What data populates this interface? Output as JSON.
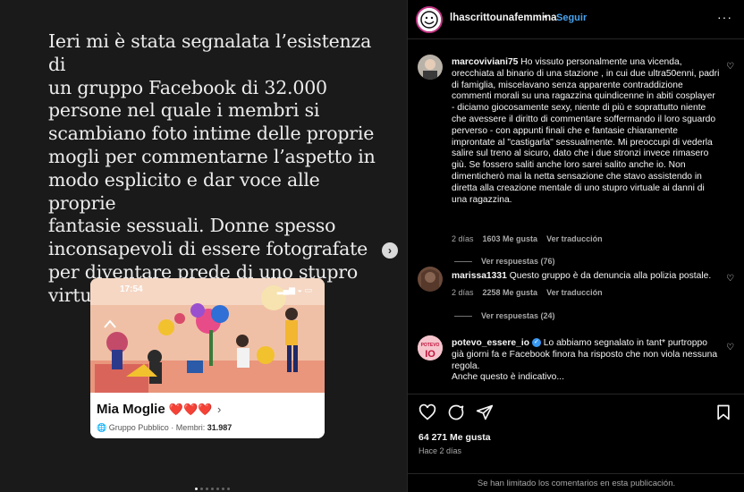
{
  "media": {
    "text_lines": [
      "Ieri mi è stata segnalata l’esistenza di",
      "un gruppo Facebook di 32.000",
      "persone nel quale i membri si",
      "scambiano foto intime delle proprie",
      "mogli per commentarne l’aspetto in",
      "modo esplicito e dar voce alle proprie",
      "fantasie sessuali. Donne spesso",
      "inconsapevoli di essere fotografate",
      "per diventare prede di uno stupro",
      "virtuale."
    ],
    "card": {
      "time": "17:54",
      "title": "Mia Moglie",
      "hearts": "❤️❤️❤️",
      "chevron": "›",
      "group_type": "Gruppo Pubblico · Membri: ",
      "members": "31.987"
    },
    "next_arrow": "›"
  },
  "header": {
    "username": "lhascrittounafemmina",
    "dot": "•",
    "follow": "Seguir",
    "more": "···"
  },
  "comments": [
    {
      "user": "marcoviviani75",
      "text": "Ho vissuto personalmente una vicenda, orecchiata al binario di una stazione , in cui due ultra50enni, padri di famiglia, miscelavano senza apparente contraddizione commenti morali su una ragazzina quindicenne in abiti cosplayer - diciamo giocosamente sexy, niente di più e soprattutto niente che avessere il diritto di commentare soffermando il loro sguardo perverso - con appunti finali che e fantasie chiaramente improntate al \"castigarla\" sessualmente. Mi preoccupi di vederla salire sul treno al sicuro, dato che i due stronzi invece rimasero giù. Se fossero saliti anche loro sarei salito anche io. Non dimenticherò mai la netta sensazione che stavo assistendo in diretta alla creazione mentale di uno stupro virtuale ai danni di una ragazzina.",
      "time": "2 días",
      "likes": "1603 Me gusta",
      "translate": "Ver traducción",
      "replies": "Ver respuestas (76)"
    },
    {
      "user": "marissa1331",
      "text": "Questo gruppo è da denuncia alla polizia postale.",
      "time": "2 días",
      "likes": "2258 Me gusta",
      "translate": "Ver traducción",
      "replies": "Ver respuestas (24)"
    },
    {
      "user": "potevo_essere_io",
      "text": "Lo abbiamo segnalato in tant* purtroppo già giorni fa e Facebook finora ha risposto che non viola nessuna regola.",
      "text2": "Anche questo è indicativo...",
      "verified": true
    }
  ],
  "footer": {
    "likes": "64 271 Me gusta",
    "ago": "Hace 2 días",
    "limited": "Se han limitado los comentarios en esta publicación."
  },
  "icons": [
    "heart-icon",
    "comment-icon",
    "share-icon",
    "save-icon",
    "more-icon",
    "chevron-right-icon"
  ]
}
